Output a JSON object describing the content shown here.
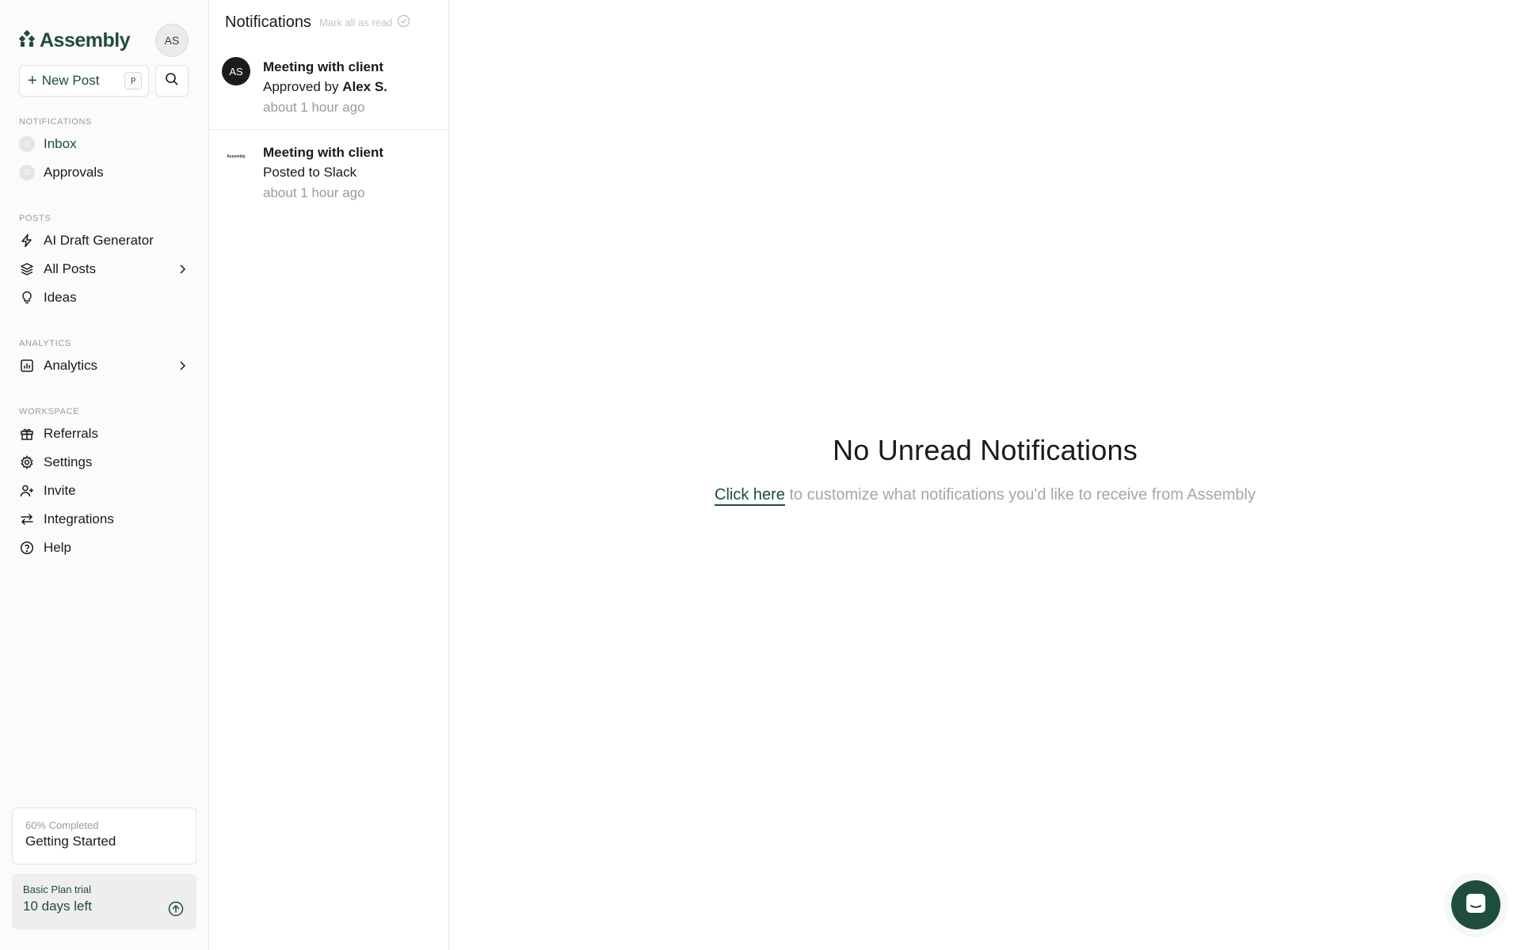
{
  "brand": {
    "name": "Assembly",
    "user_initials": "AS"
  },
  "actions": {
    "new_post_label": "New Post",
    "new_post_shortcut": "P"
  },
  "nav": {
    "notifications": {
      "label": "NOTIFICATIONS",
      "items": [
        {
          "label": "Inbox",
          "count": "0"
        },
        {
          "label": "Approvals",
          "count": "0"
        }
      ]
    },
    "posts": {
      "label": "POSTS",
      "items": [
        {
          "label": "AI Draft Generator"
        },
        {
          "label": "All Posts"
        },
        {
          "label": "Ideas"
        }
      ]
    },
    "analytics": {
      "label": "ANALYTICS",
      "items": [
        {
          "label": "Analytics"
        }
      ]
    },
    "workspace": {
      "label": "WORKSPACE",
      "items": [
        {
          "label": "Referrals"
        },
        {
          "label": "Settings"
        },
        {
          "label": "Invite"
        },
        {
          "label": "Integrations"
        },
        {
          "label": "Help"
        }
      ]
    }
  },
  "progress": {
    "caption": "60% Completed",
    "title": "Getting Started",
    "percent": 60
  },
  "trial": {
    "caption": "Basic Plan trial",
    "days_left": "10 days left"
  },
  "notifications_panel": {
    "title": "Notifications",
    "mark_all_label": "Mark all as read",
    "items": [
      {
        "title": "Meeting with client",
        "prefix": "Approved by ",
        "actor": "Alex S.",
        "time": "about 1 hour ago",
        "avatar_initials": "AS"
      },
      {
        "title": "Meeting with client",
        "prefix": "Posted to Slack",
        "time": "about 1 hour ago",
        "avatar_logo": "Assembly"
      }
    ]
  },
  "empty_state": {
    "title": "No Unread Notifications",
    "link_text": "Click here",
    "rest_text": " to customize what notifications you'd like to receive from Assembly"
  },
  "colors": {
    "brand": "#1e4d3c",
    "muted": "#9a9a9a",
    "border": "#e7e7e7"
  }
}
